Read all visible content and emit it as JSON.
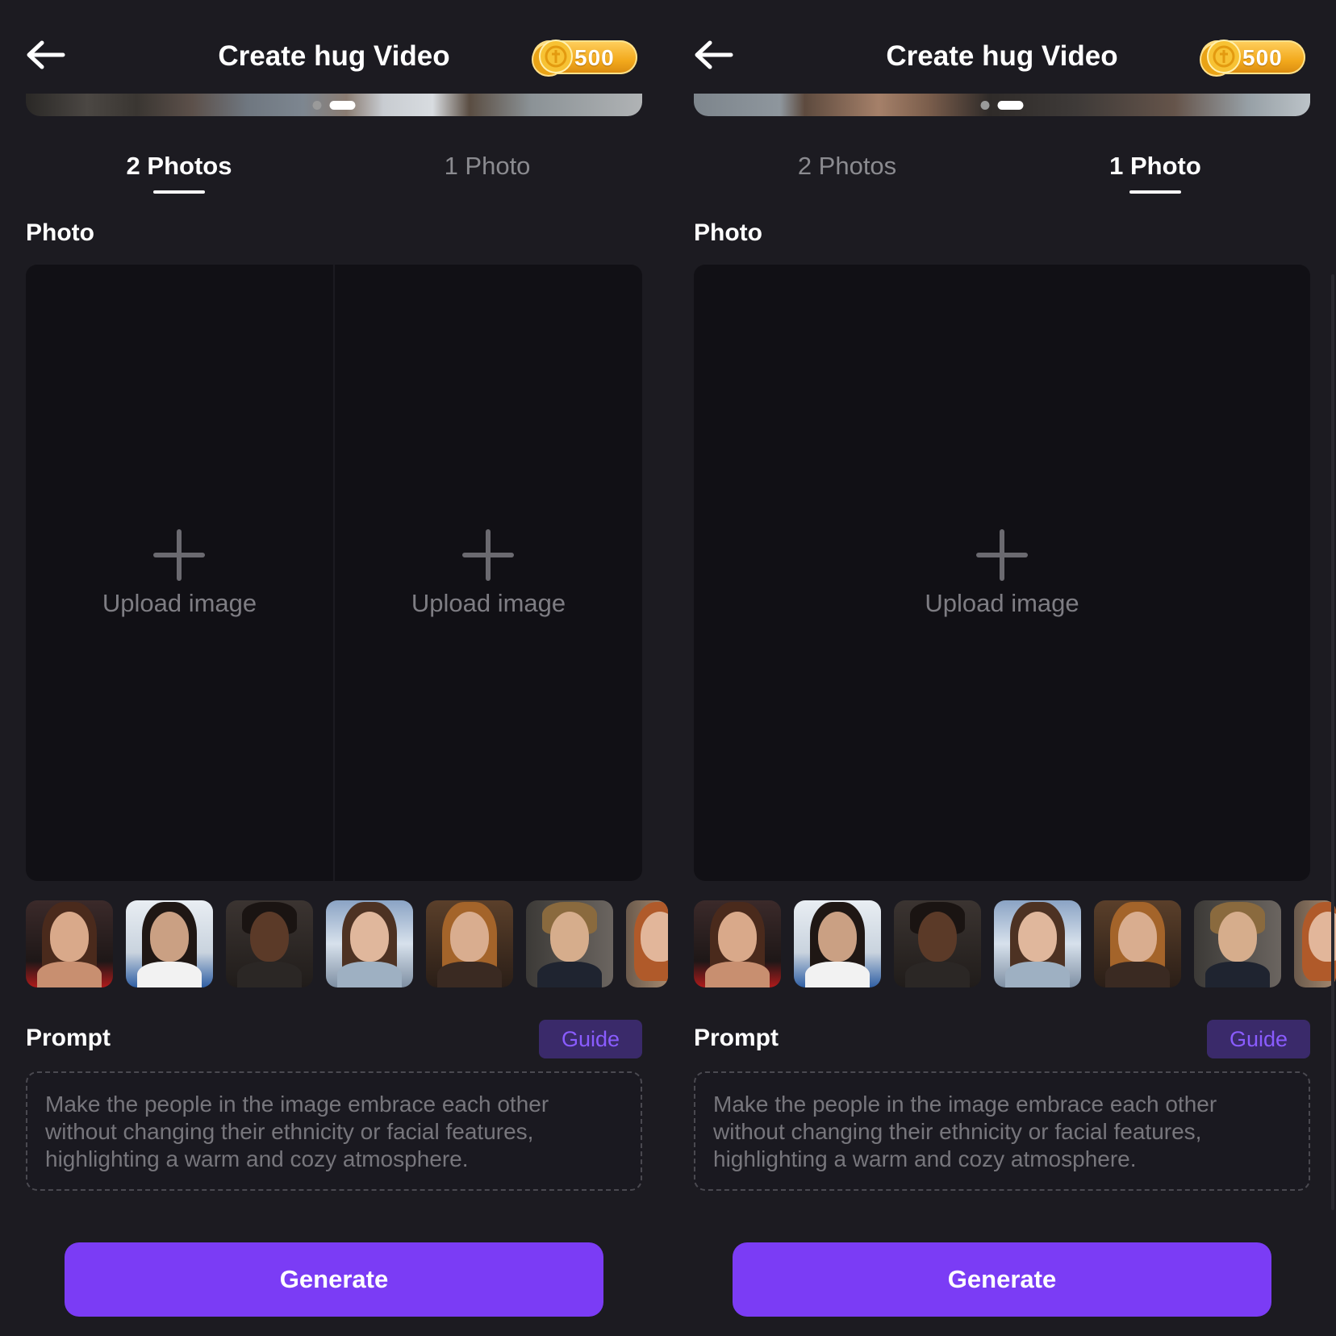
{
  "screens": [
    {
      "header": {
        "title": "Create hug Video",
        "coins": "500"
      },
      "tabs": [
        {
          "label": "2 Photos",
          "active": true
        },
        {
          "label": "1 Photo",
          "active": false
        }
      ],
      "photo_label": "Photo",
      "upload_slots": [
        {
          "label": "Upload image"
        },
        {
          "label": "Upload image"
        }
      ],
      "prompt_label": "Prompt",
      "guide_label": "Guide",
      "prompt_text": "Make the people in the image embrace each other without changing their ethnicity or facial features, highlighting a warm and cozy atmosphere.",
      "generate_label": "Generate"
    },
    {
      "header": {
        "title": "Create hug Video",
        "coins": "500"
      },
      "tabs": [
        {
          "label": "2 Photos",
          "active": false
        },
        {
          "label": "1 Photo",
          "active": true
        }
      ],
      "photo_label": "Photo",
      "upload_slots": [
        {
          "label": "Upload image"
        }
      ],
      "prompt_label": "Prompt",
      "guide_label": "Guide",
      "prompt_text": "Make the people in the image embrace each other without changing their ethnicity or facial features, highlighting a warm and cozy atmosphere.",
      "generate_label": "Generate"
    }
  ],
  "colors": {
    "background": "#1c1b21",
    "upload_area": "#111015",
    "accent": "#7b3cf5",
    "guide_bg": "#3a2a6a",
    "guide_text": "#8a5cff",
    "coin": "#f2a91c"
  },
  "icons": {
    "back": "back-arrow-icon",
    "coin": "coin-icon",
    "plus": "plus-icon"
  }
}
